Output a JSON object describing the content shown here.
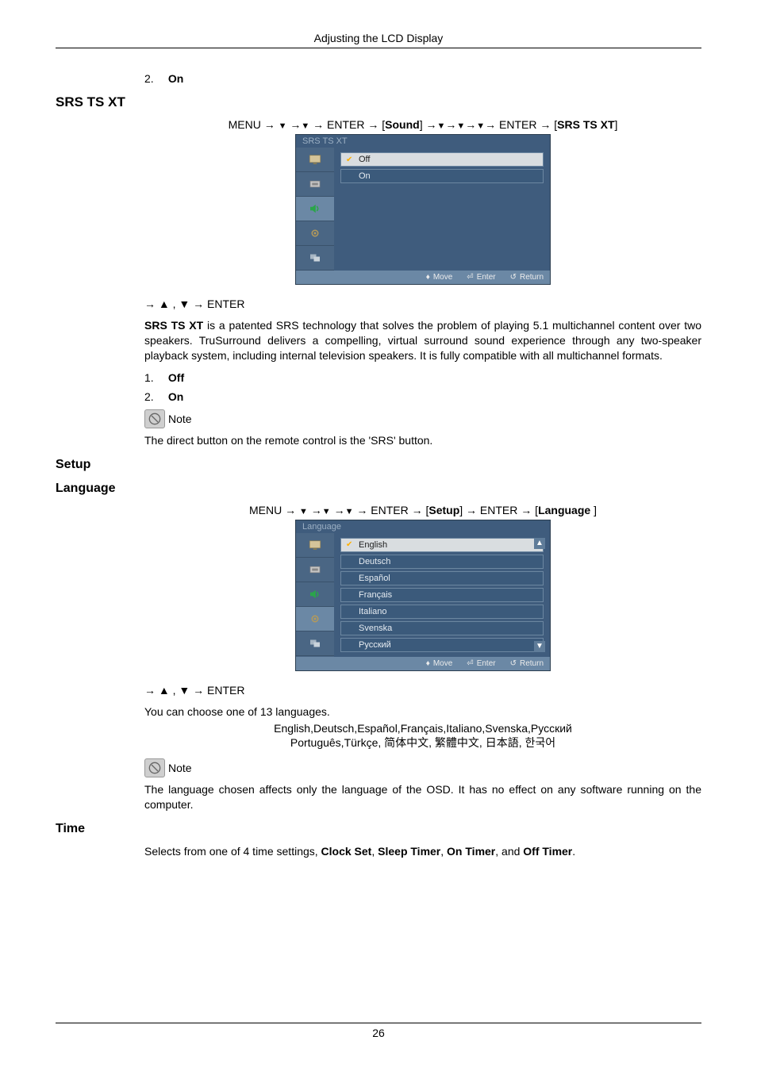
{
  "header": {
    "title": "Adjusting the LCD Display"
  },
  "top_list": {
    "num": "2.",
    "label": "On"
  },
  "srs": {
    "heading": "SRS TS XT",
    "nav": "MENU → ▼ →▼ → ENTER → [Sound] →▼→▼→▼→ ENTER → [SRS TS XT]",
    "menu": {
      "title": "SRS TS XT",
      "items": [
        {
          "label": "Off",
          "selected": true,
          "checked": true
        },
        {
          "label": "On",
          "selected": false,
          "checked": false
        }
      ],
      "footer": {
        "move": "Move",
        "enter": "Enter",
        "ret": "Return"
      }
    },
    "nav2": "→ ▲ , ▼ → ENTER",
    "para": "SRS TS XT is a patented SRS technology that solves the problem of playing 5.1 multichannel content over two speakers. TruSurround delivers a compelling, virtual surround sound experience through any two-speaker playback system, including internal television speakers. It is fully compatible with all multichannel formats.",
    "list": [
      {
        "num": "1.",
        "label": "Off"
      },
      {
        "num": "2.",
        "label": "On"
      }
    ],
    "note_label": "Note",
    "note_text": "The direct button on the remote control is the 'SRS' button."
  },
  "setup": {
    "heading": "Setup",
    "language": {
      "heading": "Language",
      "nav": "MENU → ▼ →▼ →▼ → ENTER → [Setup] → ENTER → [Language ]",
      "menu": {
        "title": "Language",
        "items": [
          {
            "label": "English",
            "selected": true,
            "checked": true
          },
          {
            "label": "Deutsch"
          },
          {
            "label": "Español"
          },
          {
            "label": "Français"
          },
          {
            "label": "Italiano"
          },
          {
            "label": "Svenska"
          },
          {
            "label": "Русский"
          }
        ],
        "footer": {
          "move": "Move",
          "enter": "Enter",
          "ret": "Return"
        }
      },
      "nav2": "→ ▲ , ▼ → ENTER",
      "para1": "You can choose one of 13 languages.",
      "langs_line1": "English,Deutsch,Español,Français,Italiano,Svenska,Русский",
      "langs_line2": "Português,Türkçe, 简体中文,   繁體中文, 日本語, 한국어",
      "note_label": "Note",
      "note_text": "The language chosen affects only the language of the OSD. It has no effect on any software running on the computer."
    },
    "time": {
      "heading": "Time",
      "para_parts": {
        "p1": "Selects from one of 4 time settings, ",
        "b1": "Clock Set",
        "c1": ", ",
        "b2": "Sleep Timer",
        "c2": ", ",
        "b3": "On Timer",
        "c3": ", and ",
        "b4": "Off Timer",
        "c4": "."
      }
    }
  },
  "footer": {
    "page": "26"
  }
}
